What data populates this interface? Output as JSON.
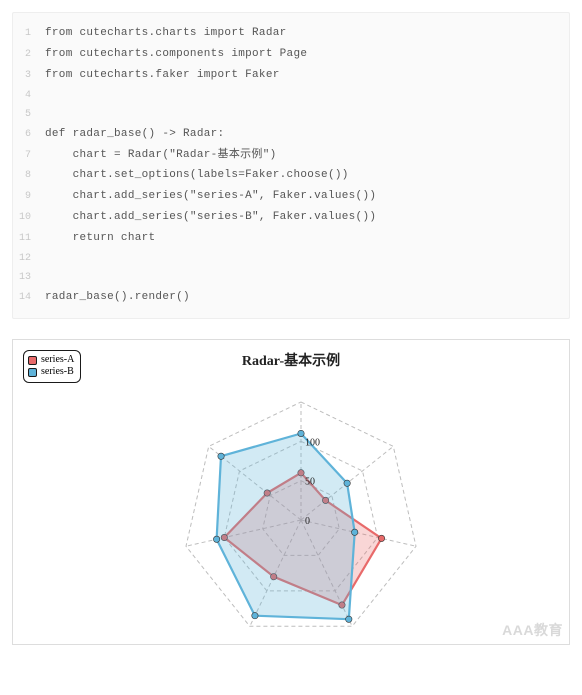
{
  "code": {
    "lines": [
      "from cutecharts.charts import Radar",
      "from cutecharts.components import Page",
      "from cutecharts.faker import Faker",
      "",
      "",
      "def radar_base() -> Radar:",
      "    chart = Radar(\"Radar-基本示例\")",
      "    chart.set_options(labels=Faker.choose())",
      "    chart.add_series(\"series-A\", Faker.values())",
      "    chart.add_series(\"series-B\", Faker.values())",
      "    return chart",
      "",
      "",
      "radar_base().render()"
    ]
  },
  "chart": {
    "title": "Radar-基本示例",
    "legend": {
      "a": "series-A",
      "b": "series-B"
    },
    "ticks": {
      "t0": "0",
      "t50": "50",
      "t100": "100"
    },
    "watermark": "AAA教育"
  },
  "chart_data": {
    "type": "radar",
    "title": "Radar-基本示例",
    "axes_count": 7,
    "value_range": [
      0,
      150
    ],
    "tick_labels": [
      0,
      50,
      100
    ],
    "series": [
      {
        "name": "series-A",
        "color": "#e86a6a",
        "values": [
          60,
          40,
          105,
          120,
          80,
          100,
          55
        ]
      },
      {
        "name": "series-B",
        "color": "#5fb3d9",
        "values": [
          110,
          75,
          70,
          140,
          135,
          110,
          130
        ]
      }
    ]
  }
}
